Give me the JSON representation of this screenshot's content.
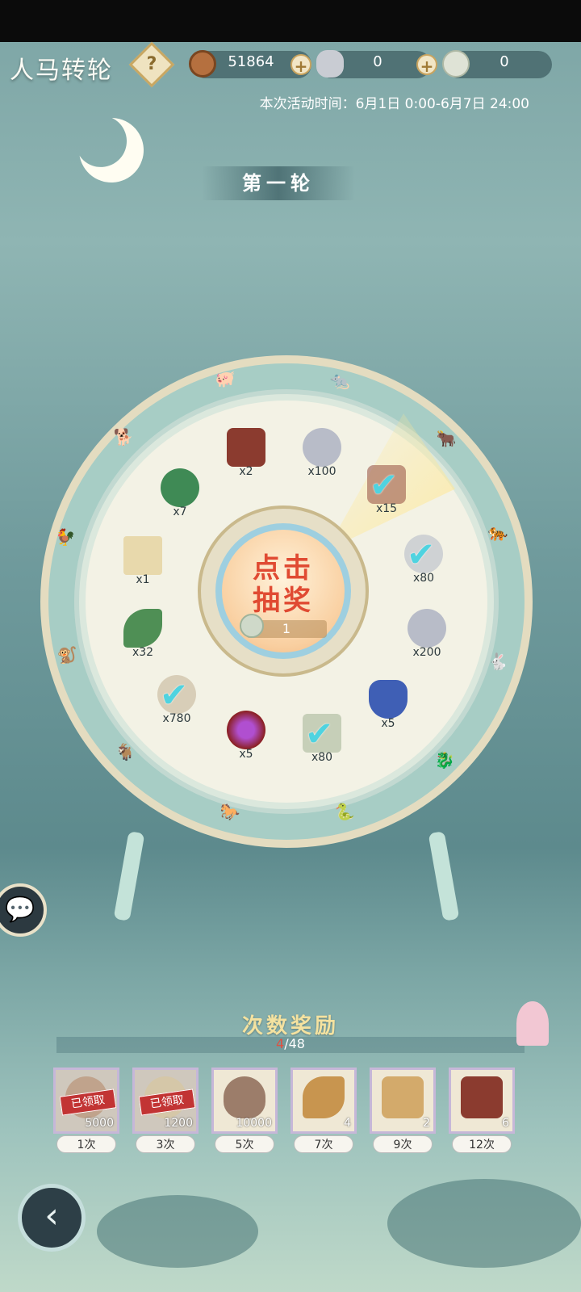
{
  "title": "人马转轮",
  "help_label": "?",
  "resources": [
    {
      "name": "copper-coin",
      "value": "51864"
    },
    {
      "name": "silver-ingot",
      "value": "0"
    },
    {
      "name": "jade-coin",
      "value": "0"
    }
  ],
  "plus": "+",
  "event_time": "本次活动时间：6月1日 0:00-6月7日 24:00",
  "round_label": "第一轮",
  "wheel": {
    "center_line1": "点击",
    "center_line2": "抽奖",
    "cost": "1",
    "slots": [
      {
        "id": "chest",
        "count": "x2",
        "claimed": false,
        "color": "#c8dbe0"
      },
      {
        "id": "silver-coin",
        "count": "x100",
        "claimed": false,
        "color": "#d5dbe6"
      },
      {
        "id": "chest",
        "count": "x15",
        "claimed": true,
        "color": "#d9c9b6"
      },
      {
        "id": "silver-coin",
        "count": "x80",
        "claimed": true,
        "color": "#cfd6cf"
      },
      {
        "id": "silver-coin",
        "count": "x200",
        "claimed": false,
        "color": "#dad8e8"
      },
      {
        "id": "crystal",
        "count": "x5",
        "claimed": false,
        "color": "#d8d3ea"
      },
      {
        "id": "scroll",
        "count": "x80",
        "claimed": true,
        "color": "#cbd4c8"
      },
      {
        "id": "purple-orb",
        "count": "x5",
        "claimed": false,
        "color": "#cbe0e6"
      },
      {
        "id": "coin",
        "count": "x780",
        "claimed": true,
        "color": "#e6d0d0"
      },
      {
        "id": "leaf",
        "count": "x32",
        "claimed": false,
        "color": "#cfe6d4"
      },
      {
        "id": "map",
        "count": "x1",
        "claimed": false,
        "color": "#f2c9c7"
      },
      {
        "id": "jade-coin",
        "count": "x7",
        "claimed": false,
        "color": "#d6d0ea"
      }
    ]
  },
  "rewards": {
    "title": "次数奖励",
    "progress_current": "4",
    "progress_total": "/48",
    "claimed_label": "已领取",
    "items": [
      {
        "id": "copper-coin",
        "amount": "5000",
        "times": "1次",
        "claimed": true
      },
      {
        "id": "jade-pendant",
        "amount": "1200",
        "times": "3次",
        "claimed": true
      },
      {
        "id": "shell",
        "amount": "10000",
        "times": "5次",
        "claimed": false
      },
      {
        "id": "key",
        "amount": "4",
        "times": "7次",
        "claimed": false
      },
      {
        "id": "wood-chest",
        "amount": "2",
        "times": "9次",
        "claimed": false
      },
      {
        "id": "treasure-chest",
        "amount": "6",
        "times": "12次",
        "claimed": false
      }
    ]
  },
  "back_label": "‹"
}
